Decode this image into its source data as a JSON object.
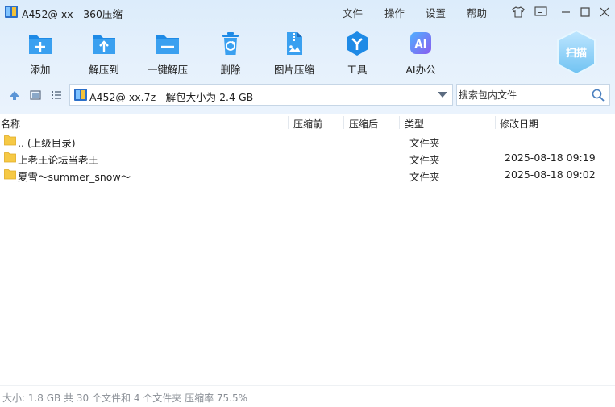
{
  "window": {
    "title": "A452@ xx - 360压缩",
    "menus": [
      "文件",
      "操作",
      "设置",
      "帮助"
    ]
  },
  "toolbar": {
    "items": [
      {
        "label": "添加",
        "icon": "add-icon"
      },
      {
        "label": "解压到",
        "icon": "extract-to-icon"
      },
      {
        "label": "一键解压",
        "icon": "one-click-extract-icon"
      },
      {
        "label": "删除",
        "icon": "trash-icon"
      },
      {
        "label": "图片压缩",
        "icon": "image-compress-icon"
      },
      {
        "label": "工具",
        "icon": "tools-icon"
      },
      {
        "label": "AI办公",
        "icon": "ai-icon"
      }
    ],
    "scan_label": "扫描"
  },
  "address": {
    "path": "A452@ xx.7z - 解包大小为 2.4 GB"
  },
  "search": {
    "placeholder": "搜索包内文件"
  },
  "columns": {
    "name": "名称",
    "before": "压缩前",
    "after": "压缩后",
    "type": "类型",
    "date": "修改日期"
  },
  "rows": [
    {
      "name": ".. (上级目录)",
      "type": "文件夹",
      "date": ""
    },
    {
      "name": "上老王论坛当老王",
      "type": "文件夹",
      "date": "2025-08-18 09:19"
    },
    {
      "name": "夏雪～summer_snow～",
      "type": "文件夹",
      "date": "2025-08-18 09:02"
    }
  ],
  "status": {
    "text": "大小: 1.8 GB 共 30 个文件和 4 个文件夹 压缩率 75.5%"
  },
  "colors": {
    "accent": "#1e8ae6",
    "folder": "#f6c945",
    "status_text": "#8a8f96"
  }
}
